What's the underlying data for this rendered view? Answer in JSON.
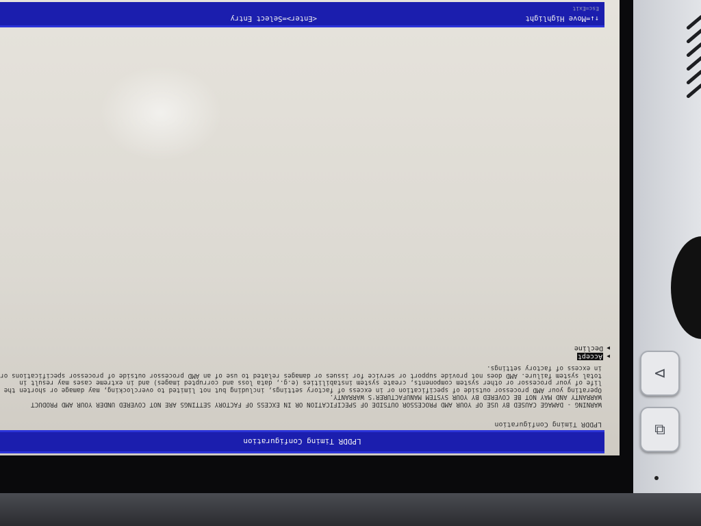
{
  "bios": {
    "title": "LPDDR Timing Configuration",
    "section_header": "LPDDR Timing Configuration",
    "warning_lines": [
      "WARNING - DAMAGE CAUSED BY USE OF YOUR AMD PROCESSOR OUTSIDE OF SPECIFICATION OR IN EXCESS OF FACTORY SETTINGS ARE NOT COVERED UNDER YOUR AMD PRODUCT",
      "WARRANTY AND MAY NOT BE COVERED BY YOUR SYSTEM MANUFACTURER'S WARRANTY.",
      "Operating your AMD processor outside of specification or in excess of factory settings, including but not limited to overclocking, may damage or shorten the",
      "life of your processor or other system components, create system instabilities (e.g., data loss and corrupted images) and in extreme cases may result in",
      "total system failure. AMD does not provide support or service for issues or damages related to use of an AMD processor outside of processor specifications or",
      "in excess of factory settings."
    ],
    "options": [
      {
        "label": "Accept",
        "selected": true
      },
      {
        "label": "Decline",
        "selected": false
      }
    ],
    "status": {
      "move": "↑↓=Move Highlight",
      "select": "<Enter>=Select Entry",
      "exit": "Esc=Exit"
    }
  },
  "colors": {
    "bar_blue": "#1b1eae",
    "screen_bg": "#dcd9d2"
  },
  "icons": [
    "triangle-icon",
    "square-icon"
  ]
}
